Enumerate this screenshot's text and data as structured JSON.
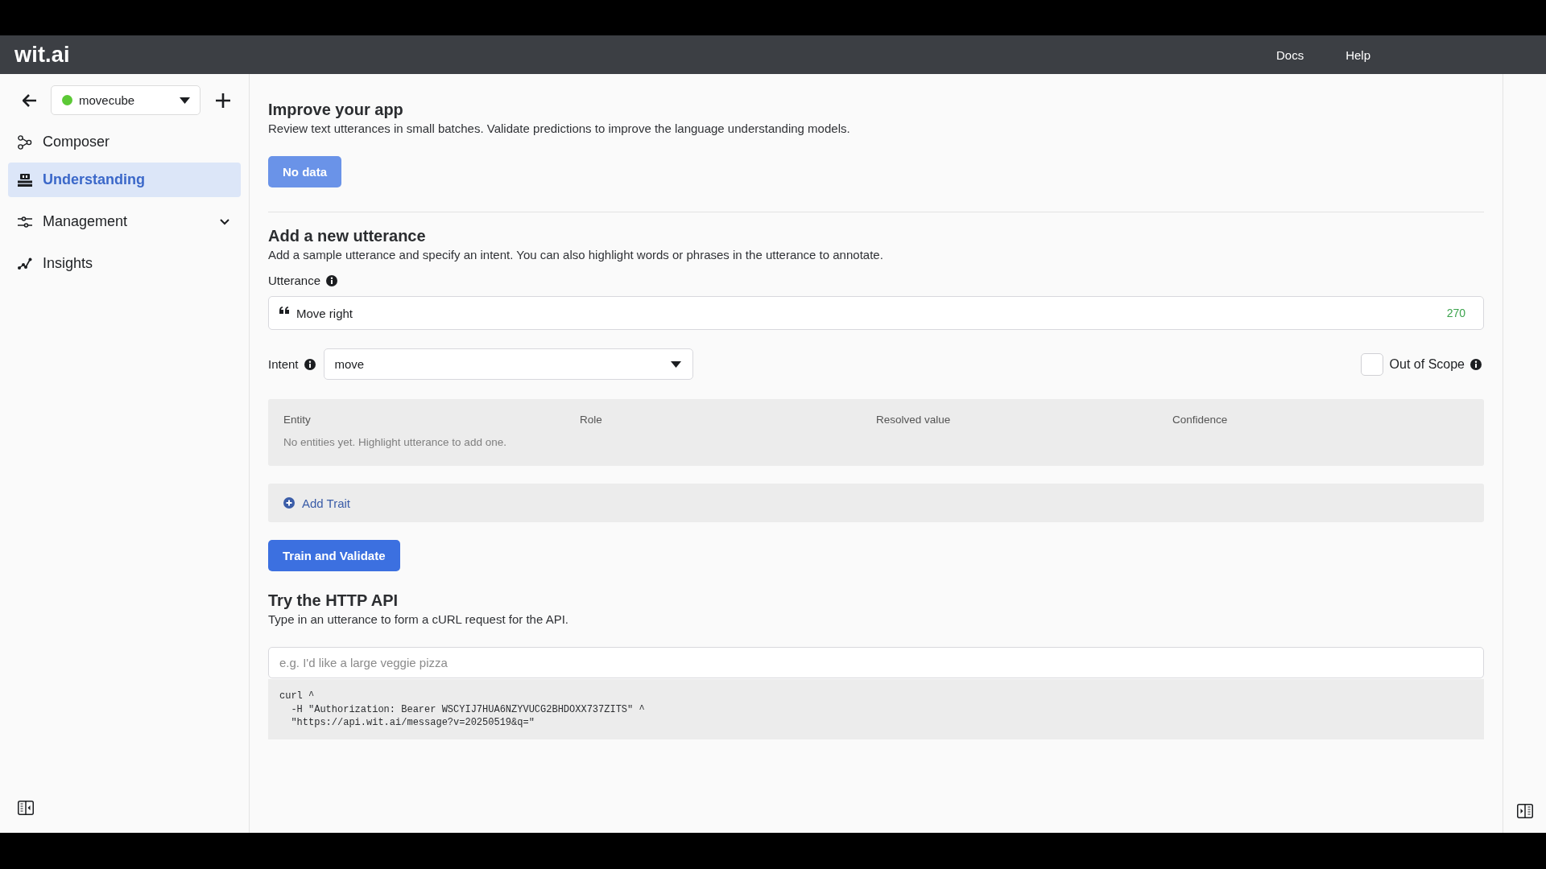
{
  "header": {
    "logo": "wit.ai",
    "links": [
      {
        "label": "Docs"
      },
      {
        "label": "Help"
      }
    ]
  },
  "sidebar": {
    "app": {
      "name": "movecube",
      "active": true
    },
    "items": [
      {
        "label": "Composer",
        "kind": "link",
        "selected": false
      },
      {
        "label": "Understanding",
        "kind": "link",
        "selected": true
      },
      {
        "label": "Management",
        "kind": "group",
        "selected": false,
        "expanded": false
      },
      {
        "label": "Insights",
        "kind": "link",
        "selected": false
      }
    ]
  },
  "improve": {
    "title": "Improve your app",
    "description": "Review text utterances in small batches. Validate predictions to improve the language understanding models.",
    "button": {
      "label": "No data",
      "disabled": true
    }
  },
  "add_utterance": {
    "title": "Add a new utterance",
    "description": "Add a sample utterance and specify an intent. You can also highlight words or phrases in the utterance to annotate.",
    "utterance": {
      "label": "Utterance",
      "value": "Move right",
      "counter": "270"
    },
    "intent": {
      "label": "Intent",
      "value": "move"
    },
    "out_of_scope": {
      "label": "Out of Scope",
      "checked": false
    },
    "entities": {
      "columns": [
        "Entity",
        "Role",
        "Resolved value",
        "Confidence"
      ],
      "empty_text": "No entities yet. Highlight utterance to add one."
    },
    "add_trait": {
      "label": "Add Trait"
    },
    "submit": {
      "label": "Train and Validate",
      "disabled": false
    }
  },
  "http_api": {
    "title": "Try the HTTP API",
    "description": "Type in an utterance to form a cURL request for the API.",
    "query": {
      "placeholder": "e.g. I'd like a large veggie pizza"
    },
    "curl": [
      "curl ^",
      "  -H \"Authorization: Bearer WSCYIJ7HUA6NZYVUCG2BHDOXX737ZITS\" ^",
      "  \"https://api.wit.ai/message?v=20250519&q=\""
    ]
  }
}
